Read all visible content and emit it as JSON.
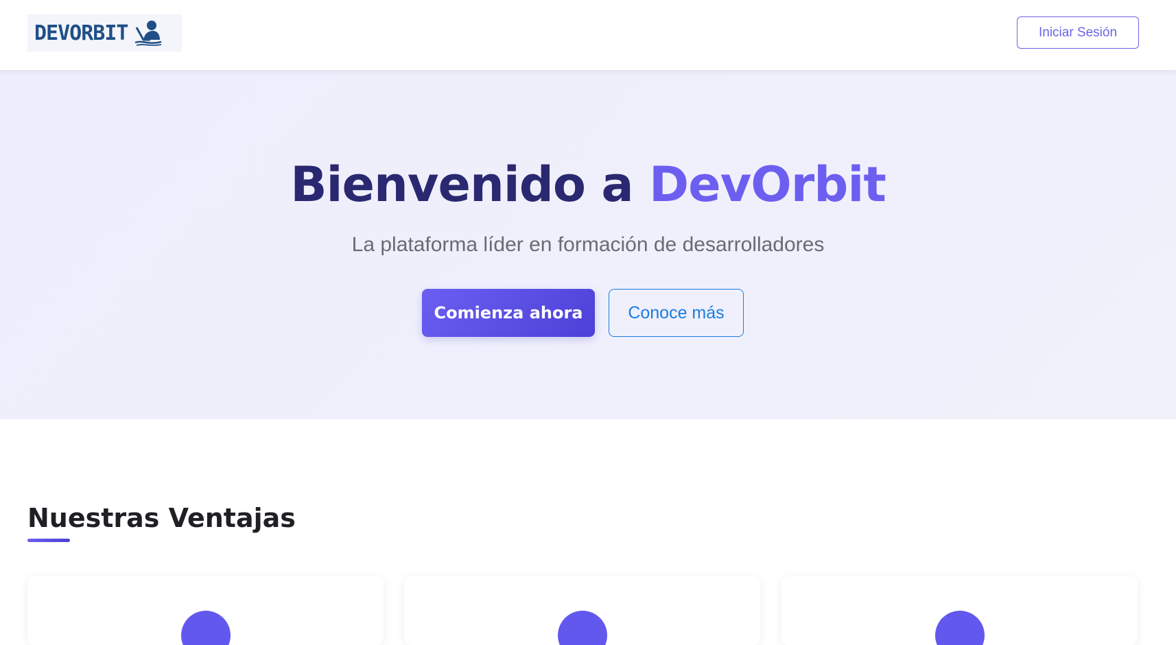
{
  "header": {
    "logo_text": "DEVORBIT",
    "login_label": "Iniciar Sesión"
  },
  "hero": {
    "title_prefix": "Bienvenido a ",
    "title_accent": "DevOrbit",
    "subtitle": "La plataforma líder en formación de desarrolladores",
    "primary_cta": "Comienza ahora",
    "secondary_cta": "Conoce más"
  },
  "features": {
    "title": "Nuestras Ventajas"
  },
  "colors": {
    "brand_primary": "#6c5ff0",
    "brand_dark": "#2a2870",
    "link_blue": "#1a7de0"
  }
}
